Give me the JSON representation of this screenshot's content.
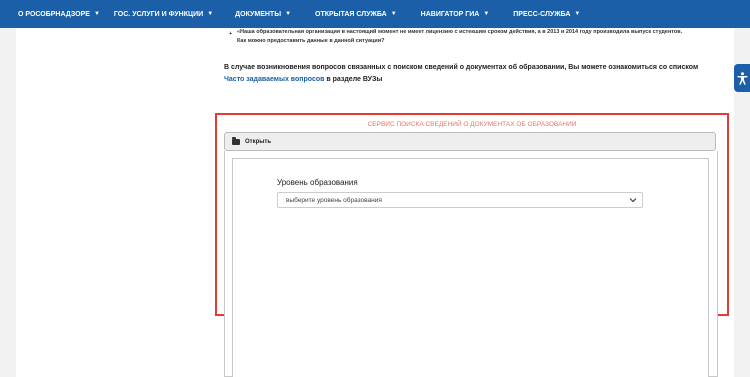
{
  "nav": {
    "items": [
      {
        "label": "О РОСОБРНАДЗОРЕ"
      },
      {
        "label": "ГОС. УСЛУГИ И ФУНКЦИИ"
      },
      {
        "label": "ДОКУМЕНТЫ"
      },
      {
        "label": "ОТКРЫТАЯ СЛУЖБА"
      },
      {
        "label": "НАВИГАТОР ГИА"
      },
      {
        "label": "ПРЕСС-СЛУЖБА"
      }
    ]
  },
  "faq_excerpt": {
    "bullet": "+",
    "question_line1": "«Наша образовательная организация в настоящий момент не имеет лицензию с истекшим сроком действия, а в 2013 и 2014 году производила выпуск студентов.",
    "question_line2": "Как можно предоставить данные в данной ситуации?"
  },
  "info": {
    "line1": "В случае возникновения вопросов связанных с поиском сведений о документах об образовании, Вы можете ознакомиться со списком",
    "link": "Часто задаваемых вопросов",
    "line2_suffix": " в разделе ВУЗы"
  },
  "service": {
    "title": "СЕРВИС ПОИСКА СВЕДЕНИЙ О ДОКУМЕНТАХ ОБ ОБРАЗОВАНИИ",
    "open_label": "Открыть",
    "form": {
      "level_label": "Уровень образования",
      "level_selected": "выберите уровень образования"
    }
  },
  "colors": {
    "nav_bg": "#1a5fa8",
    "highlight_frame": "#e53935",
    "service_title": "#e57373",
    "link": "#1a5fa8"
  }
}
